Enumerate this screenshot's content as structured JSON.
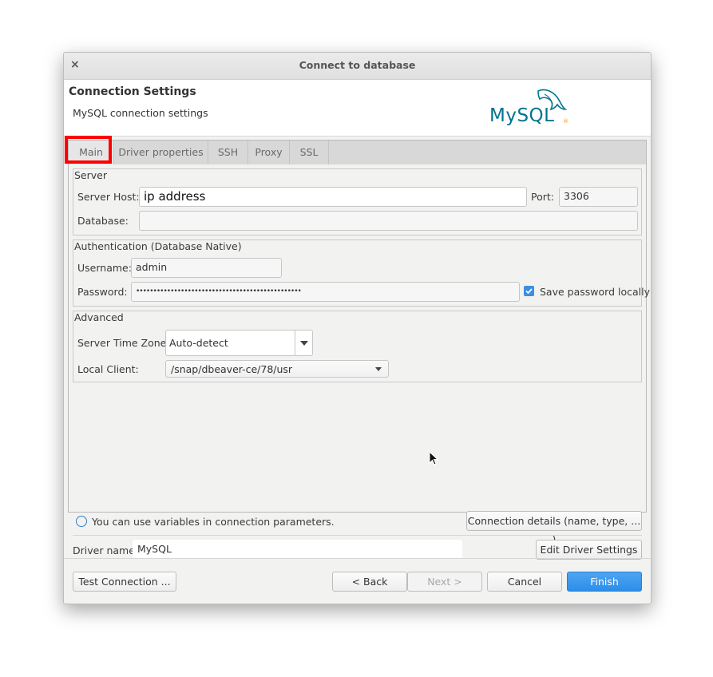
{
  "window": {
    "title": "Connect to database",
    "close_glyph": "×"
  },
  "header": {
    "title": "Connection Settings",
    "subtitle": "MySQL connection settings",
    "logo_text": "MySQL",
    "logo_mark": "®",
    "logo_icon": "dolphin-icon"
  },
  "tabs": [
    {
      "label": "Main",
      "active": true
    },
    {
      "label": "Driver properties",
      "active": false
    },
    {
      "label": "SSH",
      "active": false
    },
    {
      "label": "Proxy",
      "active": false
    },
    {
      "label": "SSL",
      "active": false
    }
  ],
  "server": {
    "group_label": "Server",
    "host_label": "Server Host:",
    "host_value": "ip address",
    "port_label": "Port:",
    "port_value": "3306",
    "database_label": "Database:",
    "database_value": ""
  },
  "auth": {
    "group_label": "Authentication (Database Native)",
    "username_label": "Username:",
    "username_value": "admin",
    "password_label": "Password:",
    "password_value": "••••••••••••••••••••••••••••••••••••••••••••••••",
    "save_password_label": "Save password locally",
    "save_password_checked": true
  },
  "advanced": {
    "group_label": "Advanced",
    "timezone_label": "Server Time Zone:",
    "timezone_value": "Auto-detect",
    "client_label": "Local Client:",
    "client_value": "/snap/dbeaver-ce/78/usr"
  },
  "info": {
    "text": "You can use variables in connection parameters.",
    "icon": "info-icon"
  },
  "buttons": {
    "connection_details": "Connection details (name, type, ... )",
    "edit_driver": "Edit Driver Settings",
    "test_connection": "Test Connection ...",
    "back": "< Back",
    "next": "Next >",
    "cancel": "Cancel",
    "finish": "Finish"
  },
  "driver": {
    "label": "Driver name:",
    "value": "MySQL"
  },
  "colors": {
    "accent": "#3c8fe0",
    "highlight": "#ff0000",
    "mysql_blue": "#00758f",
    "mysql_orange": "#f29111"
  }
}
